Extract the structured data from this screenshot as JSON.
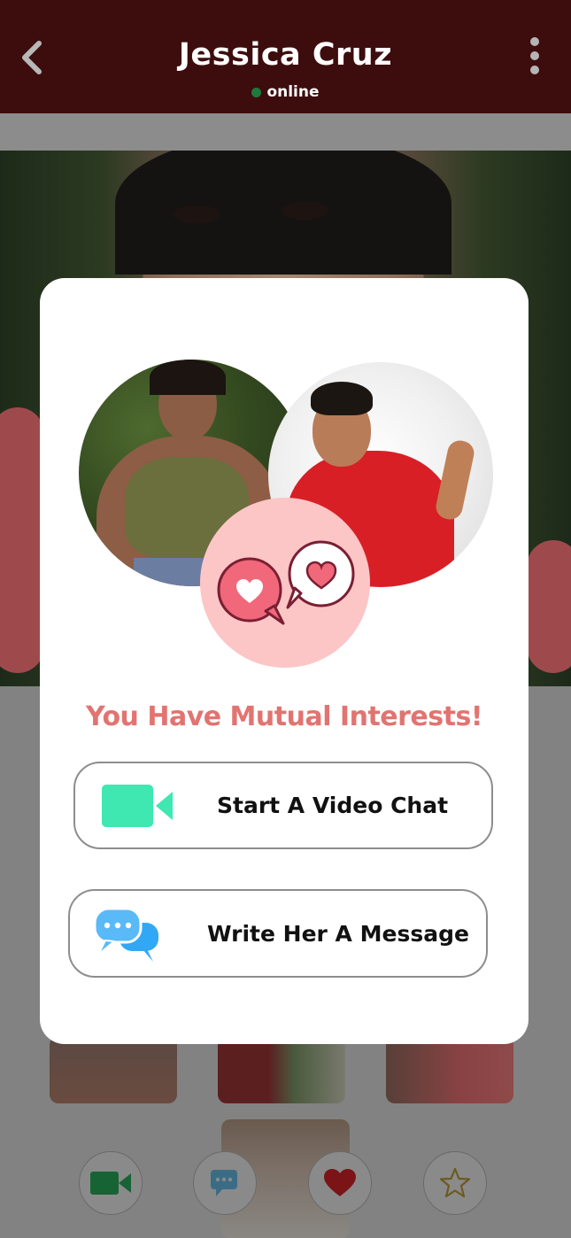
{
  "header": {
    "title": "Jessica Cruz",
    "status": "online",
    "colors": {
      "background": "#3d0d0e",
      "online_dot": "#1e7a3a"
    }
  },
  "modal": {
    "headline": "You Have Mutual Interests!",
    "options": [
      {
        "label": "Start A Video Chat",
        "icon": "video-camera-icon"
      },
      {
        "label": "Write Her A Message",
        "icon": "chat-bubbles-icon"
      }
    ],
    "colors": {
      "headline": "#e17471",
      "badge": "#fcc5c6",
      "video_icon": "#3ee8b0",
      "message_icon": "#31a8f5"
    }
  },
  "bottom_actions": [
    {
      "name": "video-call",
      "icon": "video-camera-icon"
    },
    {
      "name": "message",
      "icon": "chat-icon"
    },
    {
      "name": "like",
      "icon": "heart-icon"
    },
    {
      "name": "favorite",
      "icon": "star-icon"
    }
  ]
}
